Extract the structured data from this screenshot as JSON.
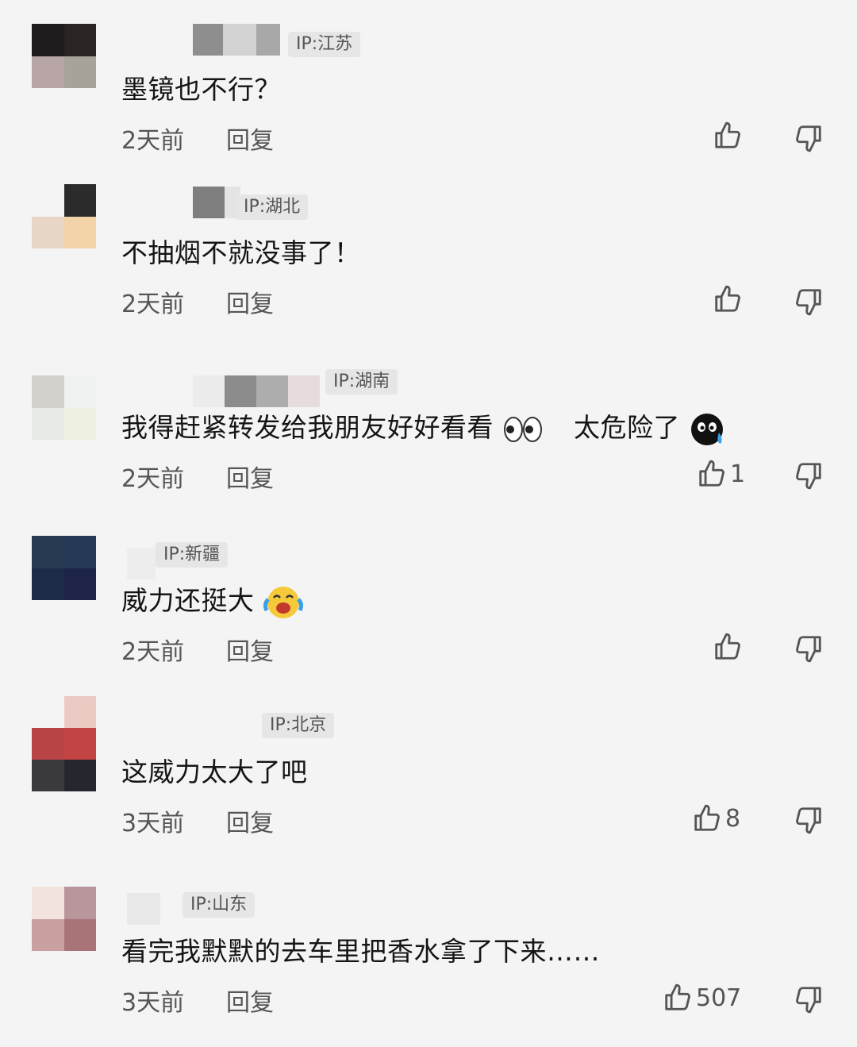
{
  "comments": [
    {
      "ip": "IP:江苏",
      "text": "墨镜也不行？",
      "time": "2天前",
      "reply": "回复",
      "likes": "",
      "avatar": [
        "#1e1c1c",
        "#2a2424",
        "#b8a6a6",
        "#a8a398"
      ]
    },
    {
      "ip": "IP:湖北",
      "text": "不抽烟不就没事了！",
      "time": "2天前",
      "reply": "回复",
      "likes": "",
      "avatar": [
        "#f4f4f4",
        "#2b2b2b",
        "#e8d6c6",
        "#f3d4a8"
      ]
    },
    {
      "ip": "IP:湖南",
      "text": "我得赶紧转发给我朋友好好看看",
      "text2": "太危险了",
      "time": "2天前",
      "reply": "回复",
      "likes": "1",
      "avatar": [
        "#d4d0cc",
        "#eef2f0",
        "#e8eae8",
        "#eef0e2"
      ]
    },
    {
      "ip": "IP:新疆",
      "text": "威力还挺大",
      "time": "2天前",
      "reply": "回复",
      "likes": "",
      "avatar": [
        "#283a52",
        "#243a56",
        "#1c2c48",
        "#1e2448"
      ]
    },
    {
      "ip": "IP:北京",
      "text": "这威力太大了吧",
      "time": "3天前",
      "reply": "回复",
      "likes": "8",
      "avatar": [
        "#f4f4f4",
        "#eccac4",
        "#b84446",
        "#c24444",
        "#3a3a3c",
        "#24282e"
      ]
    },
    {
      "ip": "IP:山东",
      "text": "看完我默默的去车里把香水拿了下来……",
      "time": "3天前",
      "reply": "回复",
      "likes": "507",
      "avatar": [
        "#f2e4dc",
        "#b8969c",
        "#c8a0a0",
        "#a87478"
      ]
    }
  ],
  "colors": {
    "background": "#f4f4f4",
    "badge_bg": "#e6e6e6",
    "text": "#151515",
    "meta": "#555555"
  },
  "icons": {
    "like": "thumbs-up-icon",
    "dislike": "thumbs-down-icon",
    "eyes": "eyes-emoji-icon",
    "crying": "crying-emoji-icon",
    "laughing": "laughing-tears-emoji-icon"
  }
}
